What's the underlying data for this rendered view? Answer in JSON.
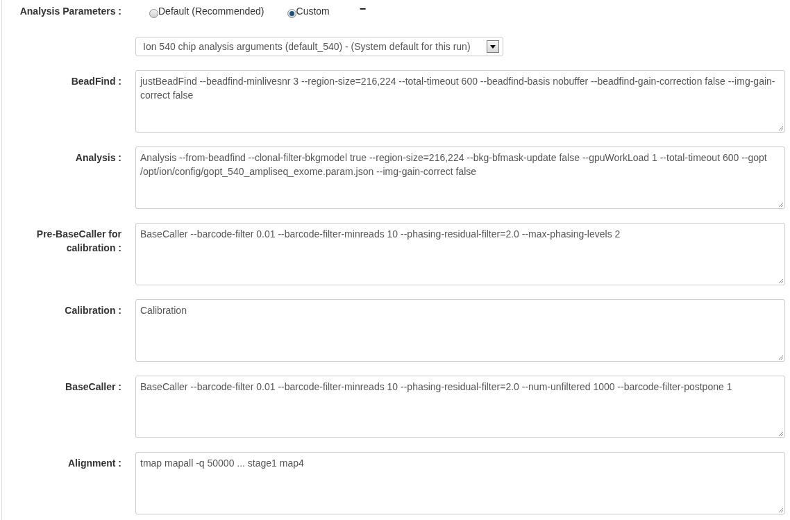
{
  "analysis_parameters": {
    "label": "Analysis Parameters :",
    "options": [
      {
        "label": "Default (Recommended)",
        "selected": false
      },
      {
        "label": "Custom",
        "selected": true
      }
    ],
    "collapse_symbol": "−",
    "preset_select": {
      "value": "Ion 540 chip analysis arguments (default_540) - (System default for this run)"
    }
  },
  "fields": [
    {
      "label": "BeadFind :",
      "value": "justBeadFind --beadfind-minlivesnr 3 --region-size=216,224 --total-timeout 600 --beadfind-basis nobuffer --beadfind-gain-correction false --img-gain-correct false"
    },
    {
      "label": "Analysis :",
      "value": "Analysis --from-beadfind --clonal-filter-bkgmodel true --region-size=216,224 --bkg-bfmask-update false --gpuWorkLoad 1 --total-timeout 600 --gopt /opt/ion/config/gopt_540_ampliseq_exome.param.json --img-gain-correct false"
    },
    {
      "label": "Pre-BaseCaller for calibration :",
      "value": "BaseCaller --barcode-filter 0.01 --barcode-filter-minreads 10 --phasing-residual-filter=2.0 --max-phasing-levels 2"
    },
    {
      "label": "Calibration :",
      "value": "Calibration"
    },
    {
      "label": "BaseCaller :",
      "value": "BaseCaller --barcode-filter 0.01 --barcode-filter-minreads 10 --phasing-residual-filter=2.0 --num-unfiltered 1000 --barcode-filter-postpone 1"
    },
    {
      "label": "Alignment :",
      "value": "tmap mapall -q 50000 ... stage1 map4"
    }
  ]
}
